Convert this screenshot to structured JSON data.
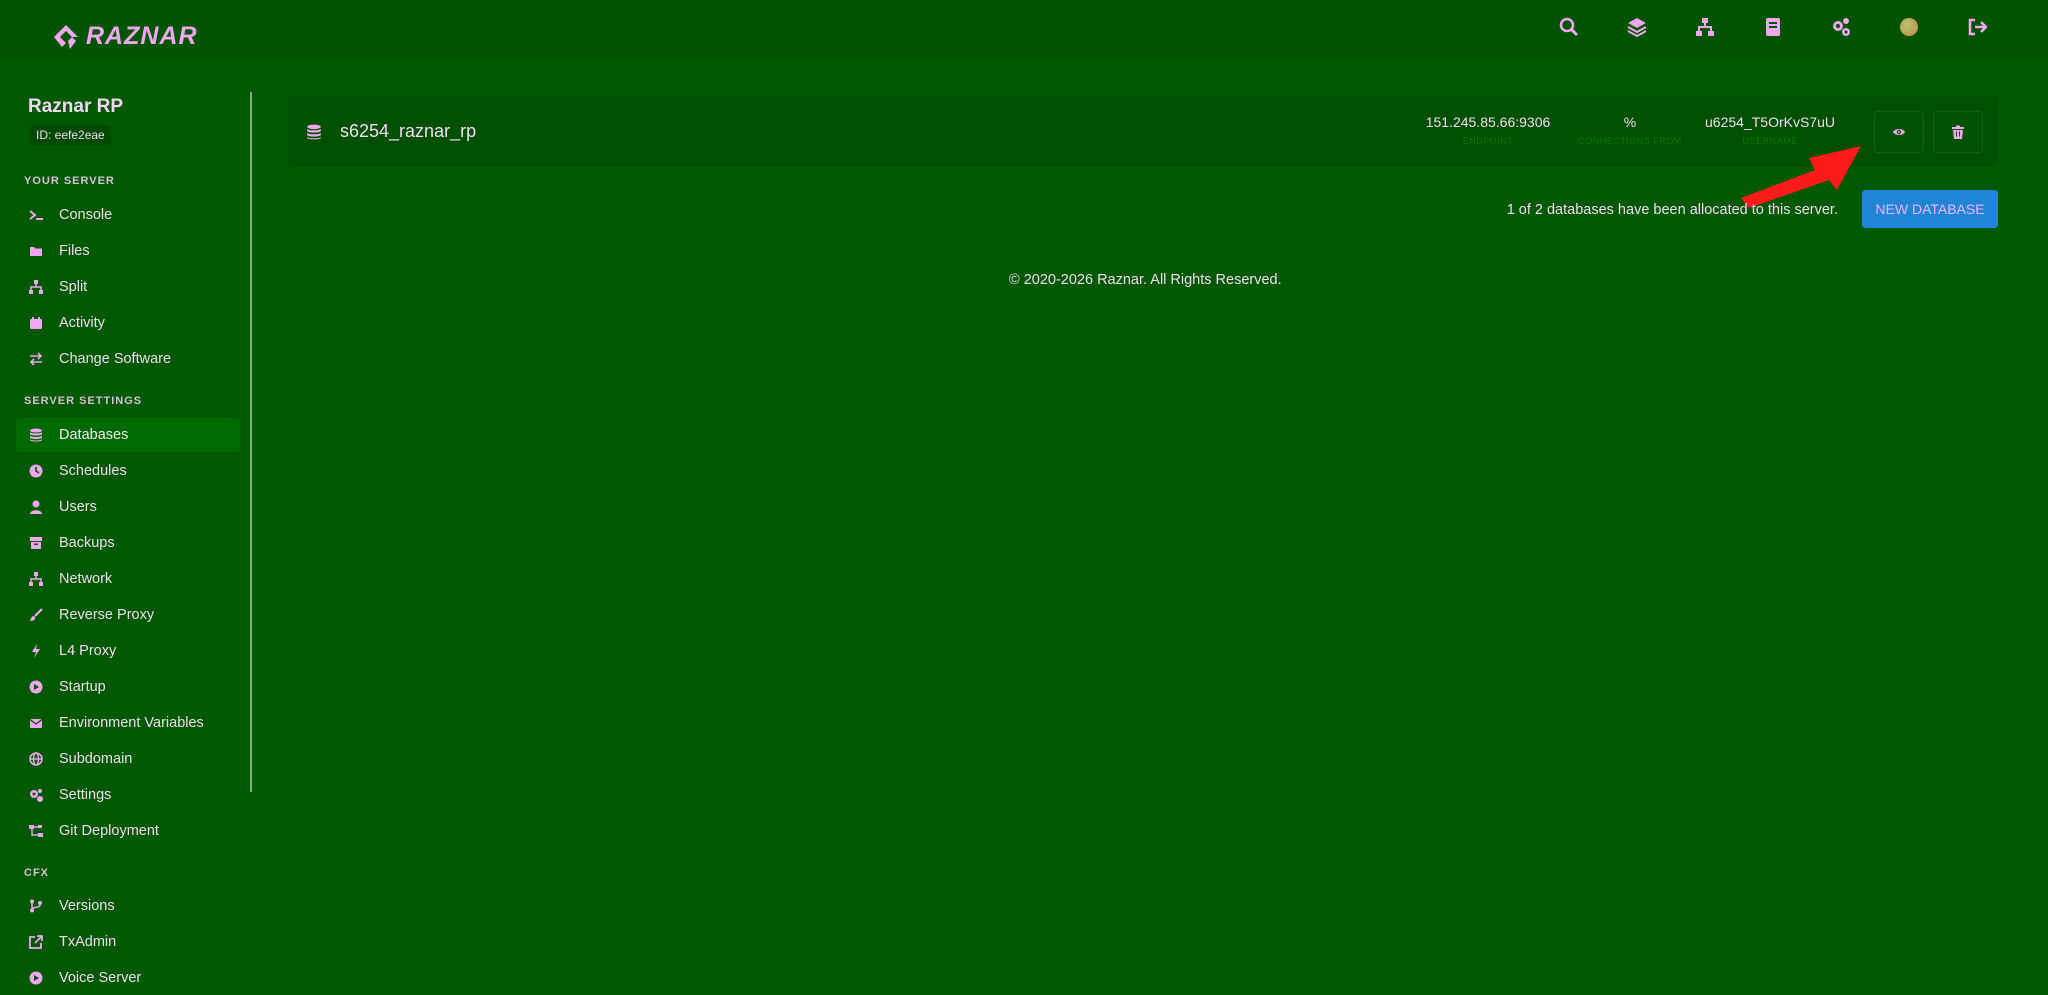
{
  "brand": {
    "name": "RAZNAR"
  },
  "header_icons": [
    {
      "name": "search-icon"
    },
    {
      "name": "layers-icon"
    },
    {
      "name": "network-icon"
    },
    {
      "name": "book-icon"
    },
    {
      "name": "cogs-icon"
    },
    {
      "name": "avatar"
    },
    {
      "name": "sign-out-icon"
    }
  ],
  "server": {
    "name": "Raznar RP",
    "id": "ID: eefe2eae"
  },
  "sidebar": {
    "section_your_server": "YOUR SERVER",
    "your_server": [
      {
        "label": "Console",
        "icon": "terminal-icon"
      },
      {
        "label": "Files",
        "icon": "folder-icon"
      },
      {
        "label": "Split",
        "icon": "sitemap-icon"
      },
      {
        "label": "Activity",
        "icon": "calendar-icon"
      },
      {
        "label": "Change Software",
        "icon": "exchange-icon"
      }
    ],
    "section_server_settings": "SERVER SETTINGS",
    "server_settings": [
      {
        "label": "Databases",
        "icon": "database-icon",
        "active": true
      },
      {
        "label": "Schedules",
        "icon": "clock-icon"
      },
      {
        "label": "Users",
        "icon": "user-icon"
      },
      {
        "label": "Backups",
        "icon": "archive-icon"
      },
      {
        "label": "Network",
        "icon": "network-icon"
      },
      {
        "label": "Reverse Proxy",
        "icon": "brush-icon"
      },
      {
        "label": "L4 Proxy",
        "icon": "bolt-icon"
      },
      {
        "label": "Startup",
        "icon": "play-icon"
      },
      {
        "label": "Environment Variables",
        "icon": "envelope-icon"
      },
      {
        "label": "Subdomain",
        "icon": "globe-icon"
      },
      {
        "label": "Settings",
        "icon": "cogs-icon"
      },
      {
        "label": "Git Deployment",
        "icon": "git-icon"
      }
    ],
    "section_cfx": "CFX",
    "cfx": [
      {
        "label": "Versions",
        "icon": "code-branch-icon"
      },
      {
        "label": "TxAdmin",
        "icon": "external-link-icon"
      },
      {
        "label": "Voice Server",
        "icon": "play-icon"
      }
    ]
  },
  "database": {
    "name": "s6254_raznar_rp",
    "endpoint": "151.245.85.66:9306",
    "endpoint_label": "ENDPOINT",
    "connections": "%",
    "connections_label": "CONNECTIONS FROM",
    "username": "u6254_T5OrKvS7uU",
    "username_label": "USERNAME"
  },
  "allocation_text": "1 of 2 databases have been allocated to this server.",
  "new_database_label": "NEW DATABASE",
  "footer": "© 2020-2026 Raznar.  All Rights Reserved.",
  "colors": {
    "background": "#005800",
    "accent": "#f0a6f0",
    "primary_button": "#1f85d6",
    "annotation_arrow": "#ff1a1a"
  }
}
